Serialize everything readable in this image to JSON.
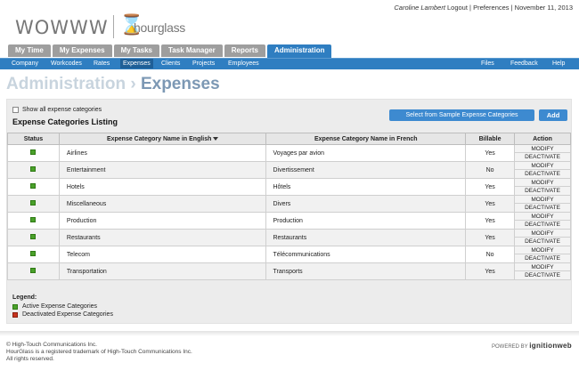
{
  "brand": {
    "company": "WOWWW",
    "product": "hourglass"
  },
  "userbar": {
    "user": "Caroline Lambert",
    "logout": "Logout",
    "sep1": "|",
    "preferences": "Preferences",
    "sep2": "|",
    "date": "November 11, 2013"
  },
  "tabs": [
    "My Time",
    "My Expenses",
    "My Tasks",
    "Task Manager",
    "Reports",
    "Administration"
  ],
  "subnav": {
    "left": [
      "Company",
      "Workcodes",
      "Rates",
      "Expenses",
      "Clients",
      "Projects",
      "Employees"
    ],
    "right": [
      "Files",
      "Feedback",
      "Help"
    ],
    "active": "Expenses"
  },
  "page": {
    "section": "Administration",
    "arrow": "›",
    "title": "Expenses"
  },
  "controls": {
    "show_all_label": "Show all expense categories",
    "listing_title": "Expense Categories Listing",
    "sample_button": "Select from Sample Expense Categories",
    "add_button": "Add"
  },
  "table": {
    "headers": {
      "status": "Status",
      "en": "Expense Category Name in English",
      "fr": "Expense Category Name in French",
      "billable": "Billable",
      "action": "Action"
    },
    "action_labels": {
      "modify": "MODIFY",
      "deactivate": "DEACTIVATE"
    },
    "rows": [
      {
        "en": "Airlines",
        "fr": "Voyages par avion",
        "billable": "Yes"
      },
      {
        "en": "Entertainment",
        "fr": "Divertissement",
        "billable": "No"
      },
      {
        "en": "Hotels",
        "fr": "Hôtels",
        "billable": "Yes"
      },
      {
        "en": "Miscellaneous",
        "fr": "Divers",
        "billable": "Yes"
      },
      {
        "en": "Production",
        "fr": "Production",
        "billable": "Yes"
      },
      {
        "en": "Restaurants",
        "fr": "Restaurants",
        "billable": "Yes"
      },
      {
        "en": "Telecom",
        "fr": "Télécommunications",
        "billable": "No"
      },
      {
        "en": "Transportation",
        "fr": "Transports",
        "billable": "Yes"
      }
    ]
  },
  "legend": {
    "title": "Legend:",
    "active": "Active Expense Categories",
    "deactivated": "Deactivated Expense Categories"
  },
  "colors": {
    "accent": "#2f7ec1",
    "active_status": "#4aa12a",
    "deactivated_status": "#c7331e"
  },
  "footer": {
    "line1": "© High-Touch Communications Inc.",
    "line2": "HourGlass is a registered trademark of High-Touch Communications Inc.",
    "line3": "All rights reserved.",
    "powered_prefix": "POWERED BY",
    "powered_brand": "ignitionweb"
  }
}
